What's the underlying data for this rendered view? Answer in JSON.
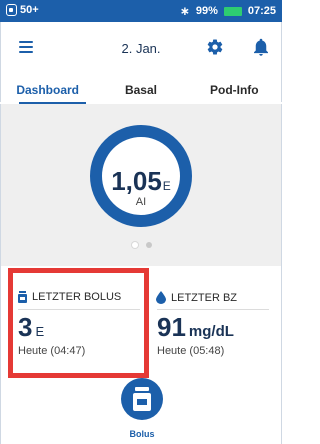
{
  "status_bar": {
    "left_text": "50+",
    "battery_percent": "99%",
    "time": "07:25",
    "battery_color": "#2ecc71"
  },
  "header": {
    "date": "2. Jan.",
    "icons": [
      "menu-icon",
      "gear-icon",
      "bell-icon"
    ]
  },
  "tabs": [
    {
      "label": "Dashboard",
      "active": true
    },
    {
      "label": "Basal",
      "active": false
    },
    {
      "label": "Pod-Info",
      "active": false
    }
  ],
  "dashboard": {
    "insulin_value": "1,05",
    "insulin_unit": "E",
    "insulin_label": "AI",
    "pager": {
      "pages": 2,
      "current": 1
    }
  },
  "last_bolus": {
    "title": "LETZTER BOLUS",
    "value": "3",
    "unit": "E",
    "time": "Heute (04:47)"
  },
  "last_bg": {
    "title": "LETZTER BZ",
    "value": "91",
    "unit": "mg/dL",
    "time": "Heute (05:48)"
  },
  "bolus_button": {
    "label": "Bolus"
  },
  "colors": {
    "primary": "#1c5faa",
    "highlight": "#e53935",
    "text_dark": "#1a3356"
  }
}
